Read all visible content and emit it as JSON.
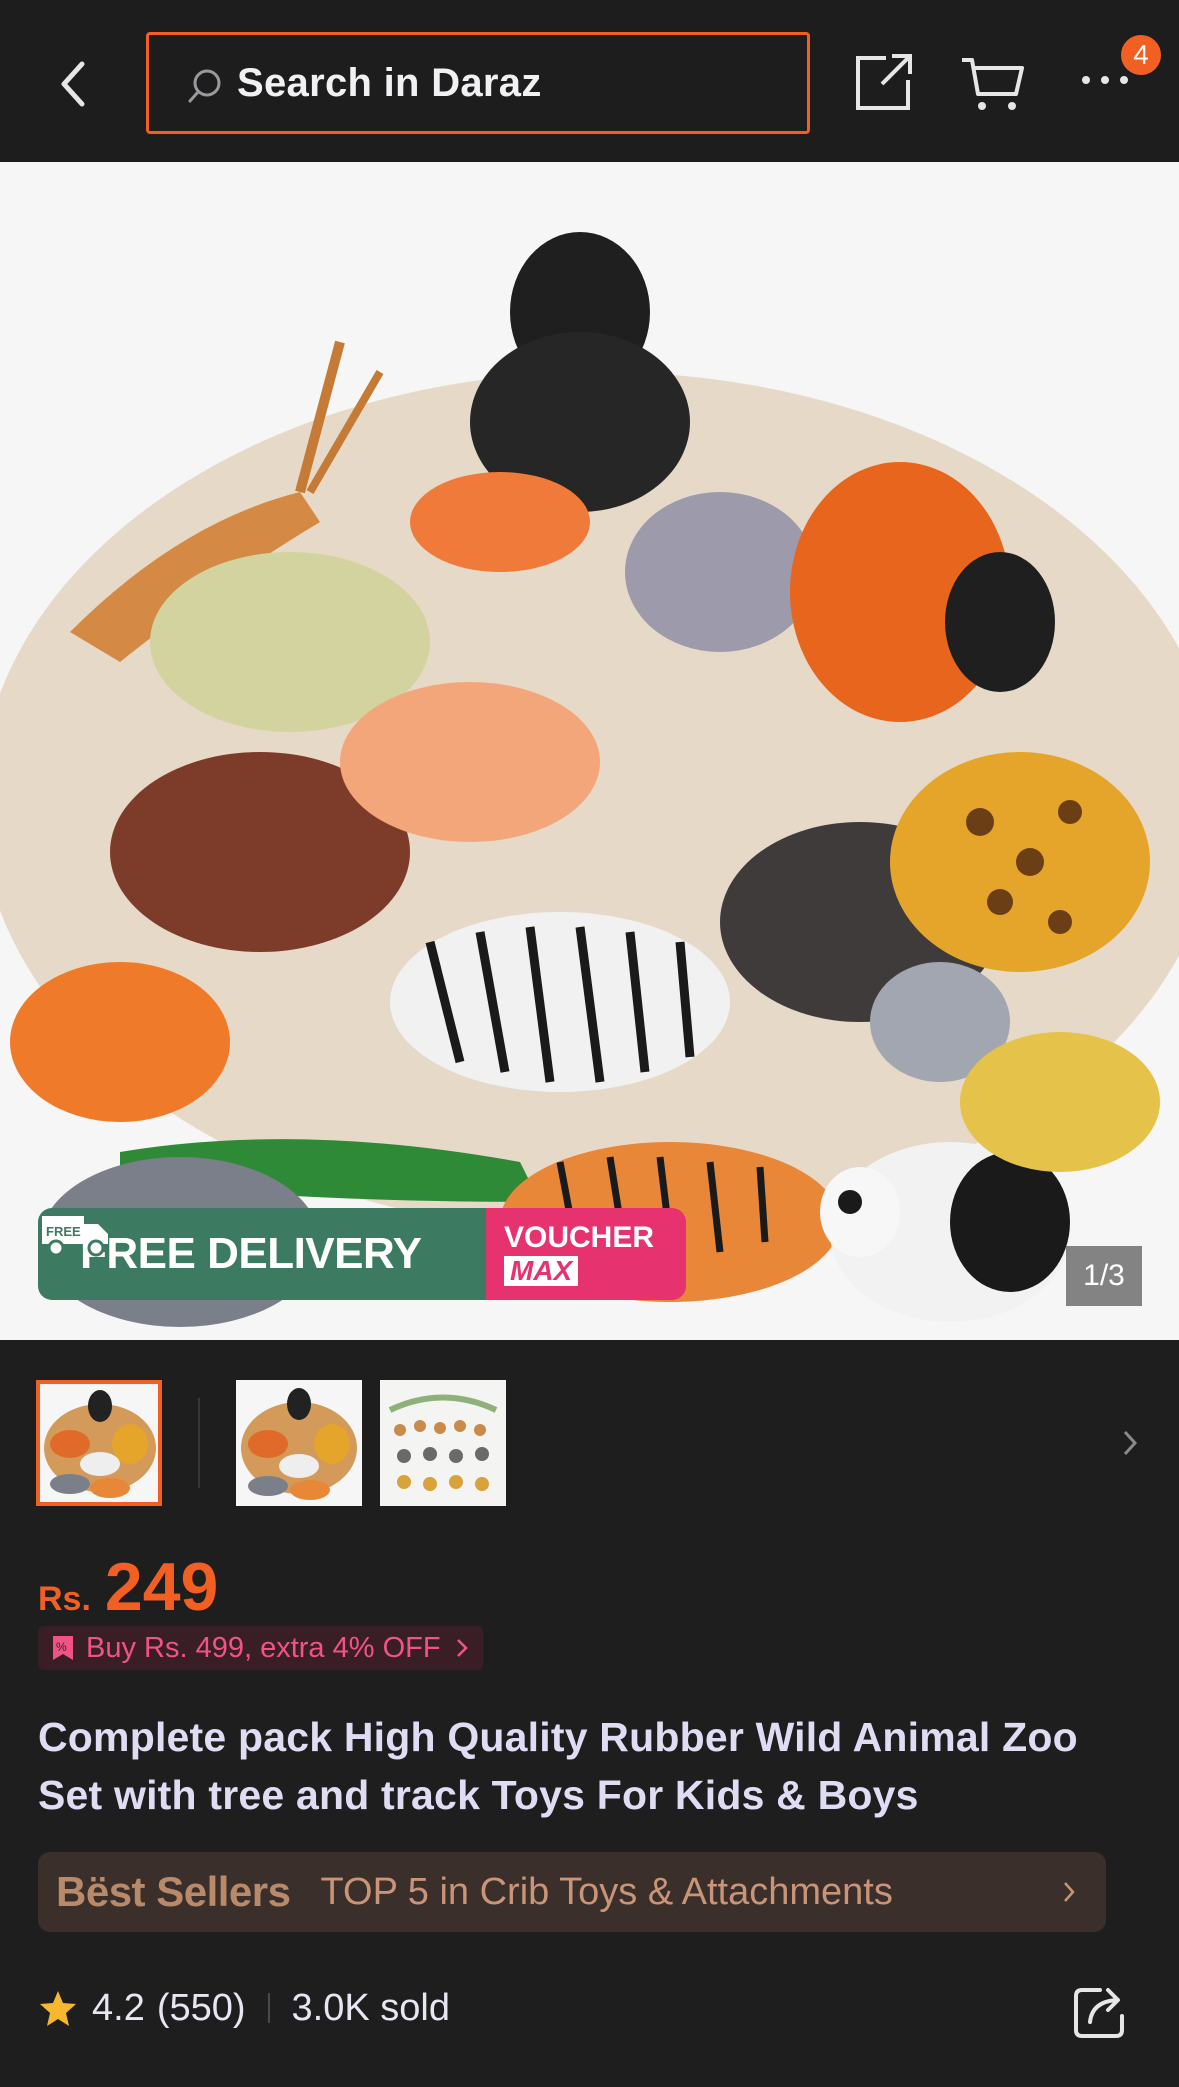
{
  "header": {
    "search_placeholder": "Search in Daraz",
    "cart_badge": "4",
    "icons": [
      "back-icon",
      "search-icon",
      "share-icon",
      "cart-icon",
      "more-icon"
    ],
    "accent_color": "#f25f22"
  },
  "gallery": {
    "delivery_label": "FREE DELIVERY",
    "delivery_icon_text": "FREE",
    "voucher_line1": "VOUCHER",
    "voucher_line2": "MAX",
    "page_indicator": "1/3",
    "thumbnails": [
      "thumb-1",
      "thumb-2",
      "thumb-3"
    ],
    "active_thumbnail": 1
  },
  "price": {
    "currency": "Rs.",
    "value": "249",
    "promo": "Buy Rs. 499, extra 4% OFF"
  },
  "product": {
    "title": "Complete pack High Quality Rubber Wild Animal Zoo Set with tree and track Toys For Kids & Boys"
  },
  "bestsellers": {
    "logo": "Bëst Sellers",
    "text": "TOP 5 in Crib Toys & Attachments"
  },
  "rating": {
    "score": "4.2",
    "count": "(550)",
    "sold": "3.0K sold"
  }
}
